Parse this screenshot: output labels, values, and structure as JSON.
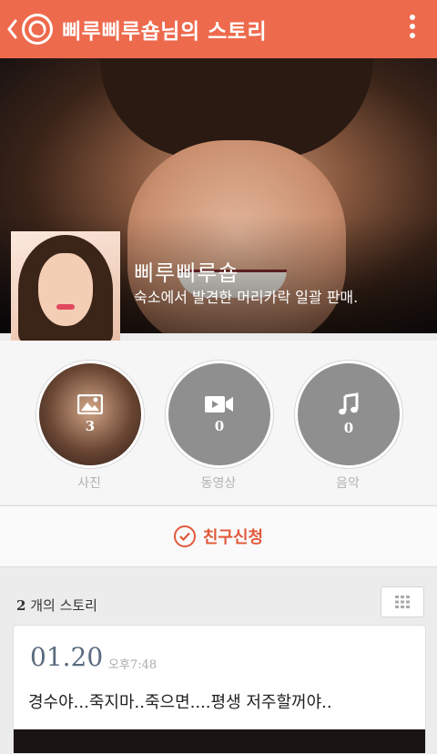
{
  "header": {
    "title": "삐루삐루숍님의 스토리",
    "back_icon": "chevron-left-icon",
    "logo_icon": "kakaostory-logo-icon",
    "more_icon": "vertical-dots-icon"
  },
  "profile": {
    "name": "삐루삐루숍",
    "status": "숙소에서 발견한 머리카락 일괄 판매."
  },
  "media": [
    {
      "icon": "photo-icon",
      "count": "3",
      "label": "사진"
    },
    {
      "icon": "video-icon",
      "count": "0",
      "label": "동영상"
    },
    {
      "icon": "music-icon",
      "count": "0",
      "label": "음악"
    }
  ],
  "friend_request": {
    "label": "친구신청"
  },
  "stories": {
    "count_number": "2",
    "count_suffix": "개의 스토리",
    "grid_icon": "grid-icon",
    "items": [
      {
        "date": "01.20",
        "time": "오후7:48",
        "text": "경수야...죽지마..죽으면....평생 저주할꺼야.."
      }
    ]
  },
  "colors": {
    "accent": "#ee6a4d",
    "button_text": "#e2583a"
  }
}
